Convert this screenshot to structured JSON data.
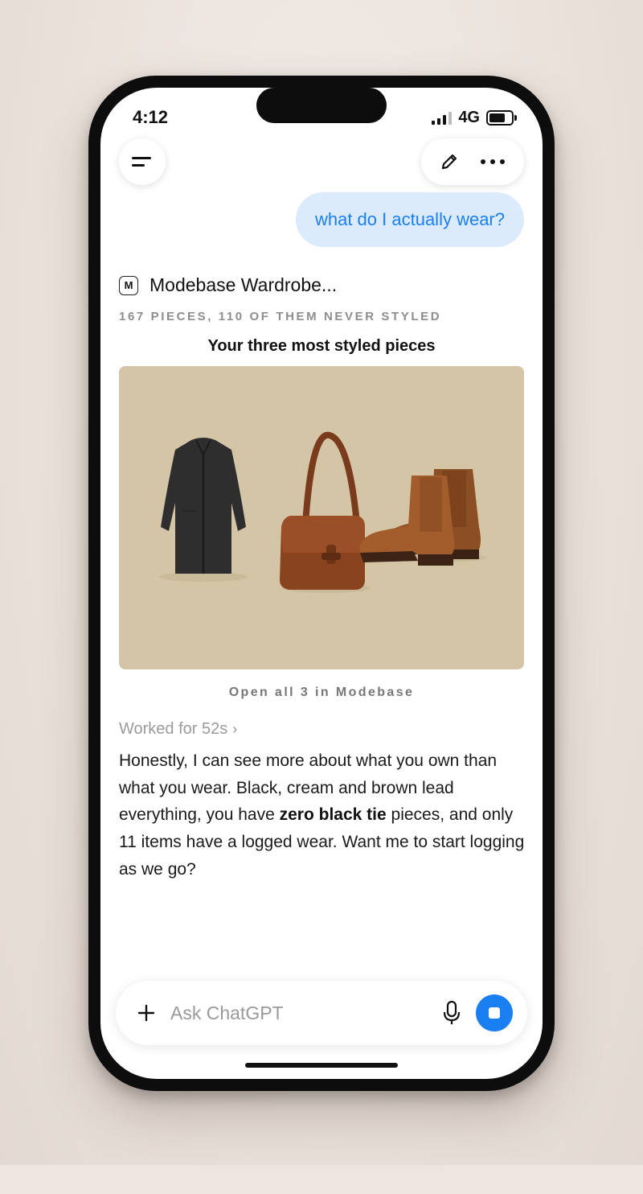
{
  "status": {
    "time": "4:12",
    "network": "4G"
  },
  "chat": {
    "user_message": "what do I actually wear?",
    "app": {
      "badge": "M",
      "name": "Modebase Wardrobe..."
    },
    "card": {
      "summary": "167 PIECES, 110 OF THEM NEVER STYLED",
      "title": "Your three most styled pieces",
      "items": [
        "black coat",
        "brown leather shoulder bag",
        "brown chelsea boots"
      ],
      "image_bg": "#d4c5a7",
      "open_link": "Open all 3 in Modebase"
    },
    "worked": "Worked for 52s",
    "reply": {
      "part1": "Honestly, I can see more about what you own than what you wear. Black, cream and brown lead everything, you have ",
      "bold": "zero black tie",
      "part2": " pieces, and only 11 items have a logged wear. Want me to start logging as we go?"
    }
  },
  "composer": {
    "placeholder": "Ask ChatGPT"
  },
  "colors": {
    "accent": "#1a7ff0",
    "user_bubble": "#dcebfb"
  },
  "icons": [
    "menu-icon",
    "edit-icon",
    "more-icon",
    "plus-icon",
    "mic-icon",
    "stop-icon",
    "chevron-right-icon"
  ]
}
